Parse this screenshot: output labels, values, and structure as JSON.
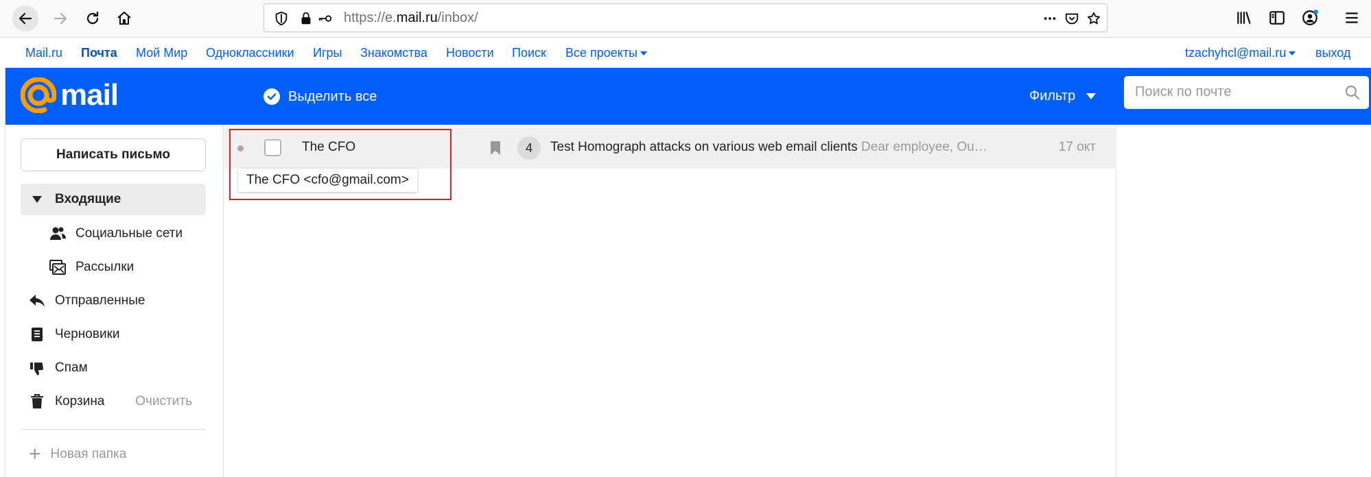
{
  "browser": {
    "url_prefix": "https://e.",
    "url_domain": "mail.ru",
    "url_path": "/inbox/",
    "icons": [
      "back-icon",
      "forward-icon",
      "reload-icon",
      "home-icon",
      "shield-icon",
      "lock-icon",
      "key-icon",
      "more-icon",
      "pocket-icon",
      "star-icon",
      "library-icon",
      "sidebar-icon",
      "account-icon",
      "menu-icon"
    ]
  },
  "portal": {
    "links": [
      "Mail.ru",
      "Почта",
      "Мой Мир",
      "Одноклассники",
      "Игры",
      "Знакомства",
      "Новости",
      "Поиск",
      "Все проекты"
    ],
    "active": "Почта",
    "user": "tzachyhcl@mail.ru",
    "logout": "выход"
  },
  "header": {
    "logo": "mail",
    "select_all": "Выделить все",
    "filter": "Фильтр",
    "search_placeholder": "Поиск по почте"
  },
  "sidebar": {
    "compose": "Написать письмо",
    "folders": [
      {
        "label": "Входящие",
        "icon": "triangle-down-icon",
        "active": true
      },
      {
        "label": "Социальные сети",
        "icon": "people-icon"
      },
      {
        "label": "Рассылки",
        "icon": "newsletter-icon"
      },
      {
        "label": "Отправленные",
        "icon": "reply-icon"
      },
      {
        "label": "Черновики",
        "icon": "draft-icon"
      },
      {
        "label": "Спам",
        "icon": "thumbs-down-icon"
      },
      {
        "label": "Корзина",
        "icon": "trash-icon"
      }
    ],
    "clear": "Очистить",
    "new_folder": "Новая папка"
  },
  "messages": [
    {
      "sender": "The CFO",
      "count": "4",
      "subject": "Test Homograph attacks on various web email clients",
      "preview": "Dear employee, Ou…",
      "date": "17 окт"
    }
  ],
  "tooltip": "The CFO <cfo@gmail.com>",
  "colors": {
    "accent": "#005ff9",
    "highlight_border": "#e31b23",
    "logo_at": "#ff9e00"
  }
}
